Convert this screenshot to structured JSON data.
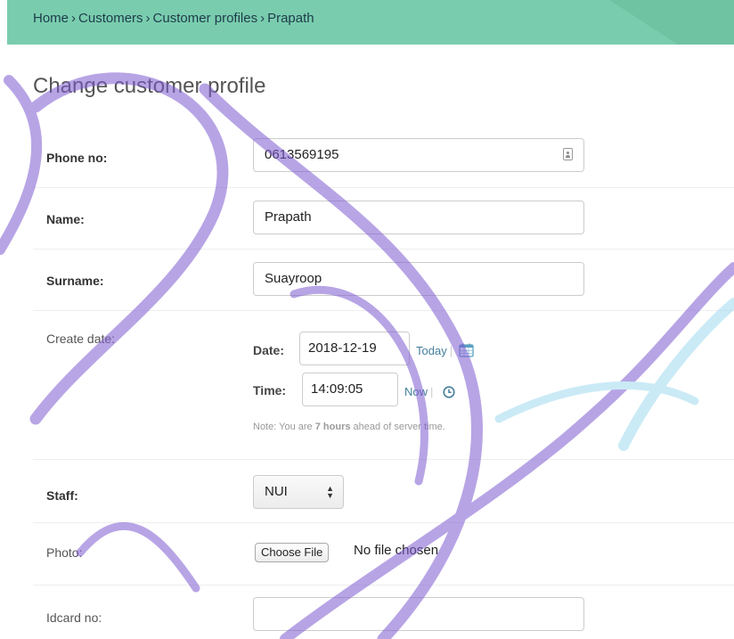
{
  "breadcrumb": {
    "items": [
      "Home",
      "Customers",
      "Customer profiles",
      "Prapath"
    ],
    "separator": "›"
  },
  "page_title": "Change customer profile",
  "fields": {
    "phone": {
      "label": "Phone no:",
      "value": "0613569195"
    },
    "name": {
      "label": "Name:",
      "value": "Prapath"
    },
    "surname": {
      "label": "Surname:",
      "value": "Suayroop"
    },
    "create_date": {
      "label": "Create date:",
      "date_label": "Date:",
      "date_value": "2018-12-19",
      "today_link": "Today",
      "time_label": "Time:",
      "time_value": "14:09:05",
      "now_link": "Now",
      "note_prefix": "Note: You are ",
      "note_bold": "7 hours",
      "note_suffix": " ahead of server time."
    },
    "staff": {
      "label": "Staff:",
      "selected": "NUI"
    },
    "photo": {
      "label": "Photo:",
      "button": "Choose File",
      "status": "No file chosen"
    },
    "idcard": {
      "label": "Idcard no:",
      "value": ""
    }
  },
  "icons": {
    "contact": "contact-card-icon",
    "calendar": "calendar-icon",
    "clock": "clock-icon"
  },
  "colors": {
    "breadcrumb_bg": "#79cdae",
    "link": "#447e9b",
    "watermark_purple": "#7d5bd0",
    "watermark_cyan": "#9fdaef"
  }
}
